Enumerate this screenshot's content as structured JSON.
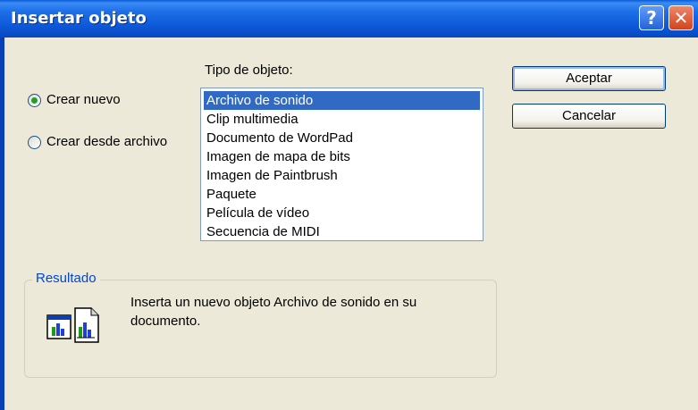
{
  "window": {
    "title": "Insertar objeto",
    "help_glyph": "?",
    "close_glyph": "✕"
  },
  "options": {
    "create_new_label": "Crear nuevo",
    "create_from_file_label": "Crear desde archivo",
    "selected": "create_new"
  },
  "object_type": {
    "label": "Tipo de objeto:",
    "items": [
      "Archivo de sonido",
      "Clip multimedia",
      "Documento de WordPad",
      "Imagen de mapa de bits",
      "Imagen de Paintbrush",
      "Paquete",
      "Película de vídeo",
      "Secuencia de MIDI"
    ],
    "selected_index": 0
  },
  "buttons": {
    "ok_label": "Aceptar",
    "cancel_label": "Cancelar"
  },
  "result": {
    "title": "Resultado",
    "text": "Inserta un nuevo objeto Archivo de sonido en su documento.",
    "icon": "insert-object-icon"
  },
  "colors": {
    "title_bar": "#0d58d8",
    "selection": "#316ac5",
    "radio_dot": "#21a121",
    "group_title": "#0046d5",
    "dialog_bg": "#ece9d8"
  }
}
